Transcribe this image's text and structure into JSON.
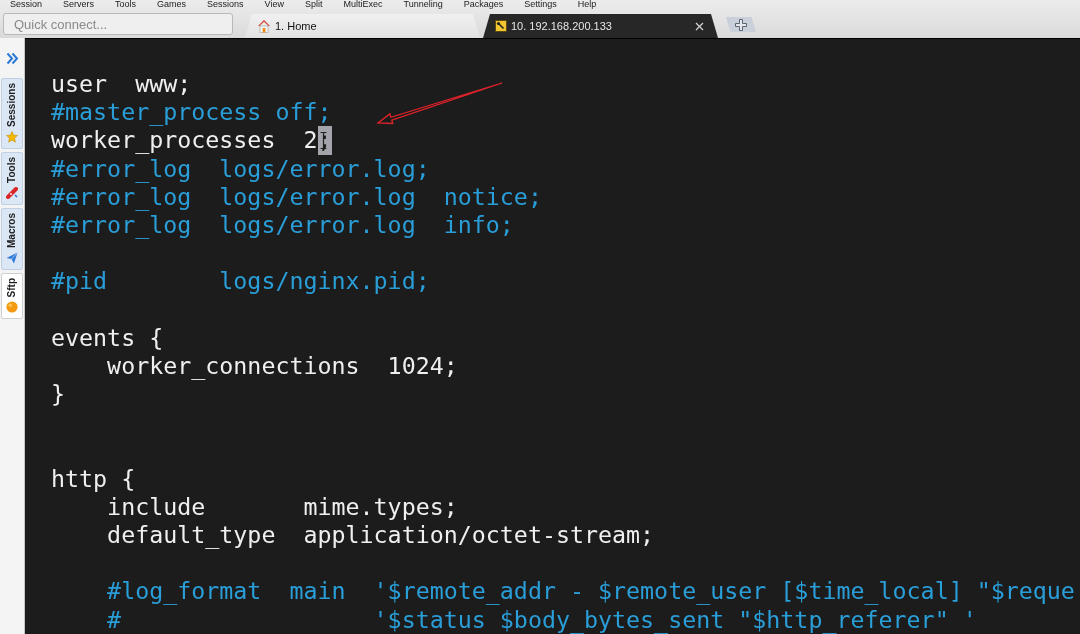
{
  "menu": [
    "Session",
    "Servers",
    "Tools",
    "Games",
    "Sessions",
    "View",
    "Split",
    "MultiExec",
    "Tunneling",
    "Packages",
    "Settings",
    "Help"
  ],
  "quick_connect": {
    "placeholder": "Quick connect..."
  },
  "tabs": [
    {
      "label": "1. Home",
      "kind": "home",
      "selected": false,
      "closable": false
    },
    {
      "label": "10. 192.168.200.133",
      "kind": "ssh",
      "selected": true,
      "closable": true
    }
  ],
  "sidebar": {
    "tabs": [
      {
        "label": "Sessions",
        "kind": "sessions",
        "selected": false
      },
      {
        "label": "Tools",
        "kind": "tools",
        "selected": false
      },
      {
        "label": "Macros",
        "kind": "macros",
        "selected": false
      },
      {
        "label": "Sftp",
        "kind": "sftp",
        "selected": true
      }
    ]
  },
  "terminal": {
    "lines": [
      {
        "kind": "code",
        "segments": [
          {
            "text": "user  www;",
            "cursor": false
          }
        ]
      },
      {
        "kind": "comment",
        "segments": [
          {
            "text": "#master_process off;",
            "cursor": false
          }
        ]
      },
      {
        "kind": "code",
        "segments": [
          {
            "text": "worker_processes  2",
            "cursor": false
          },
          {
            "text": ";",
            "cursor": true
          }
        ]
      },
      {
        "kind": "comment",
        "segments": [
          {
            "text": "#error_log  logs/error.log;",
            "cursor": false
          }
        ]
      },
      {
        "kind": "comment",
        "segments": [
          {
            "text": "#error_log  logs/error.log  notice;",
            "cursor": false
          }
        ]
      },
      {
        "kind": "comment",
        "segments": [
          {
            "text": "#error_log  logs/error.log  info;",
            "cursor": false
          }
        ]
      },
      {
        "kind": "blank"
      },
      {
        "kind": "comment",
        "segments": [
          {
            "text": "#pid        logs/nginx.pid;",
            "cursor": false
          }
        ]
      },
      {
        "kind": "blank"
      },
      {
        "kind": "code",
        "segments": [
          {
            "text": "events {",
            "cursor": false
          }
        ]
      },
      {
        "kind": "code",
        "segments": [
          {
            "text": "    worker_connections  1024;",
            "cursor": false
          }
        ]
      },
      {
        "kind": "code",
        "segments": [
          {
            "text": "}",
            "cursor": false
          }
        ]
      },
      {
        "kind": "blank"
      },
      {
        "kind": "blank"
      },
      {
        "kind": "code",
        "segments": [
          {
            "text": "http {",
            "cursor": false
          }
        ]
      },
      {
        "kind": "code",
        "segments": [
          {
            "text": "    include       mime.types;",
            "cursor": false
          }
        ]
      },
      {
        "kind": "code",
        "segments": [
          {
            "text": "    default_type  application/octet-stream;",
            "cursor": false
          }
        ]
      },
      {
        "kind": "blank"
      },
      {
        "kind": "comment",
        "segments": [
          {
            "text": "    #log_format  main  '$remote_addr - $remote_user [$time_local] \"$reque",
            "cursor": false
          }
        ]
      },
      {
        "kind": "comment",
        "segments": [
          {
            "text": "    #                  '$status $body_bytes_sent \"$http_referer\" '",
            "cursor": false
          }
        ]
      }
    ]
  }
}
